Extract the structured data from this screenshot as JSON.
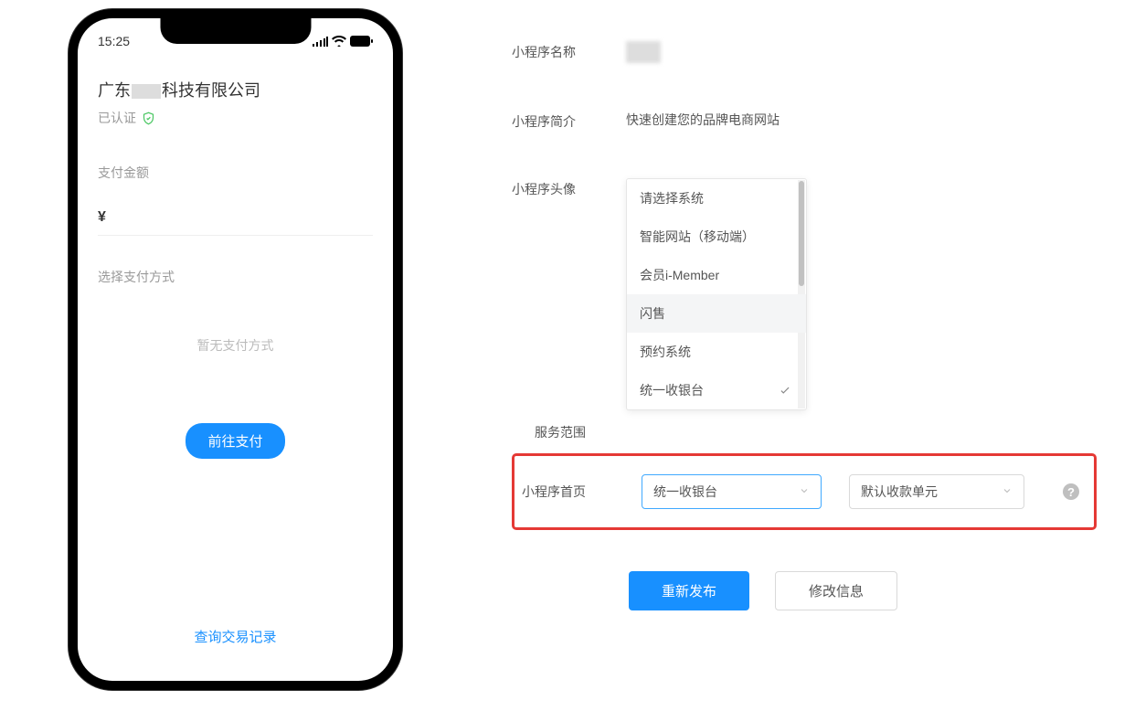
{
  "phone": {
    "time": "15:25",
    "company_prefix": "广东",
    "company_suffix": "科技有限公司",
    "verified_label": "已认证",
    "pay_amount_label": "支付金额",
    "currency_symbol": "¥",
    "select_method_label": "选择支付方式",
    "no_method_text": "暂无支付方式",
    "pay_button": "前往支付",
    "query_link": "查询交易记录"
  },
  "form": {
    "name_label": "小程序名称",
    "intro_label": "小程序简介",
    "intro_value": "快速创建您的品牌电商网站",
    "avatar_label": "小程序头像",
    "service_label": "服务范围",
    "homepage_label": "小程序首页",
    "dropdown": {
      "items": [
        "请选择系统",
        "智能网站（移动端）",
        "会员i-Member",
        "闪售",
        "预约系统",
        "统一收银台"
      ],
      "hover_index": 3,
      "selected_index": 5
    },
    "select1_value": "统一收银台",
    "select2_value": "默认收款单元",
    "republish_button": "重新发布",
    "modify_button": "修改信息"
  }
}
